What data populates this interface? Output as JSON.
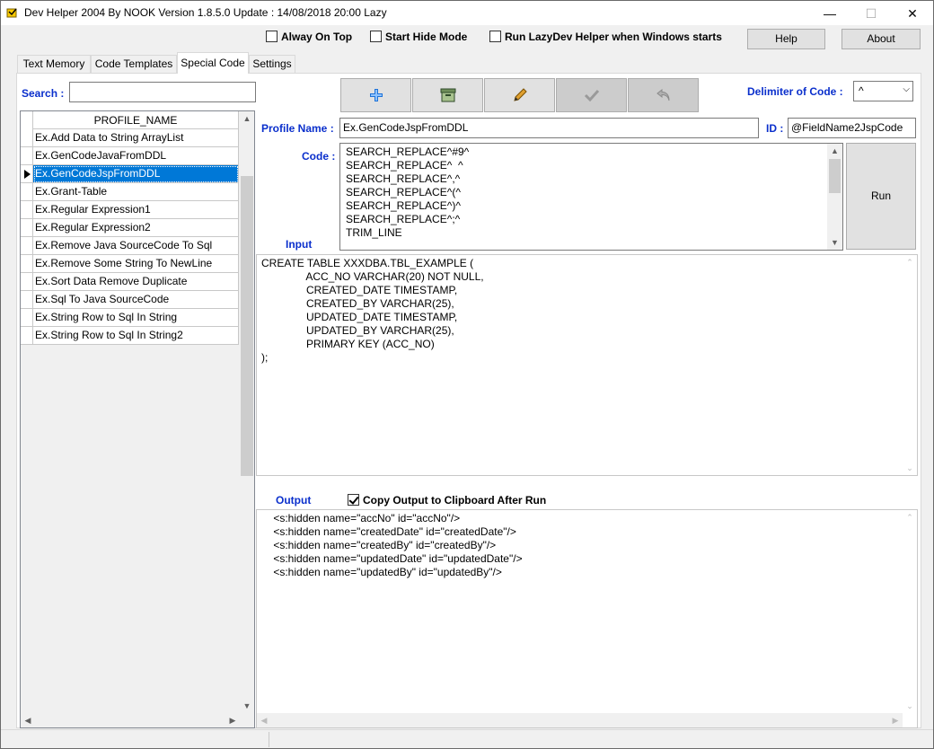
{
  "window": {
    "title": "Dev Helper 2004 By NOOK  Version 1.8.5.0  Update : 14/08/2018 20:00 Lazy",
    "min_glyph": "—",
    "max_glyph": "☐",
    "close_glyph": "✕"
  },
  "options": {
    "always_on_top": "Alway On Top",
    "start_hide_mode": "Start Hide Mode",
    "run_on_start": "Run LazyDev Helper when Windows starts"
  },
  "buttons": {
    "help": "Help",
    "about": "About",
    "run": "Run"
  },
  "tabs": [
    {
      "label": "Text Memory"
    },
    {
      "label": "Code Templates"
    },
    {
      "label": "Special Code"
    },
    {
      "label": "Settings"
    }
  ],
  "search": {
    "label": "Search :",
    "value": ""
  },
  "grid": {
    "column": "PROFILE_NAME",
    "rows": [
      "Ex.Add Data to String ArrayList",
      "Ex.GenCodeJavaFromDDL",
      "Ex.GenCodeJspFromDDL",
      "Ex.Grant-Table",
      "Ex.Regular Expression1",
      "Ex.Regular Expression2",
      "Ex.Remove Java SourceCode To Sql",
      "Ex.Remove Some String To NewLine",
      "Ex.Sort Data Remove Duplicate",
      "Ex.Sql To Java SourceCode",
      "Ex.String Row to Sql In String",
      "Ex.String Row to Sql In String2"
    ],
    "selected_index": 2
  },
  "toolbar": {
    "add_icon": "plus-icon",
    "archive_icon": "archive-icon",
    "edit_icon": "pencil-icon",
    "save_icon": "check-icon",
    "undo_icon": "undo-icon"
  },
  "delimiter": {
    "label": "Delimiter of Code :",
    "value": "^"
  },
  "profile": {
    "label": "Profile Name :",
    "value": "Ex.GenCodeJspFromDDL",
    "id_label": "ID :",
    "id_value": "@FieldName2JspCode"
  },
  "code": {
    "label": "Code :",
    "text": "SEARCH_REPLACE^#9^\nSEARCH_REPLACE^  ^\nSEARCH_REPLACE^,^\nSEARCH_REPLACE^(^\nSEARCH_REPLACE^)^\nSEARCH_REPLACE^;^\nTRIM_LINE"
  },
  "input": {
    "label": "Input",
    "text": "CREATE TABLE XXXDBA.TBL_EXAMPLE (\n               ACC_NO VARCHAR(20) NOT NULL,\n               CREATED_DATE TIMESTAMP,\n               CREATED_BY VARCHAR(25),\n               UPDATED_DATE TIMESTAMP,\n               UPDATED_BY VARCHAR(25),\n               PRIMARY KEY (ACC_NO)\n);"
  },
  "output": {
    "label": "Output",
    "copy_label": "Copy Output to Clipboard After Run",
    "text": "    <s:hidden name=\"accNo\" id=\"accNo\"/>\n    <s:hidden name=\"createdDate\" id=\"createdDate\"/>\n    <s:hidden name=\"createdBy\" id=\"createdBy\"/>\n    <s:hidden name=\"updatedDate\" id=\"updatedDate\"/>\n    <s:hidden name=\"updatedBy\" id=\"updatedBy\"/>"
  },
  "colors": {
    "accent_label": "#0a2fcc",
    "selection": "#0078d7",
    "add_icon": "#1f73d8",
    "archive_icon": "#3a7a3a",
    "pencil_icon": "#c98a12"
  }
}
